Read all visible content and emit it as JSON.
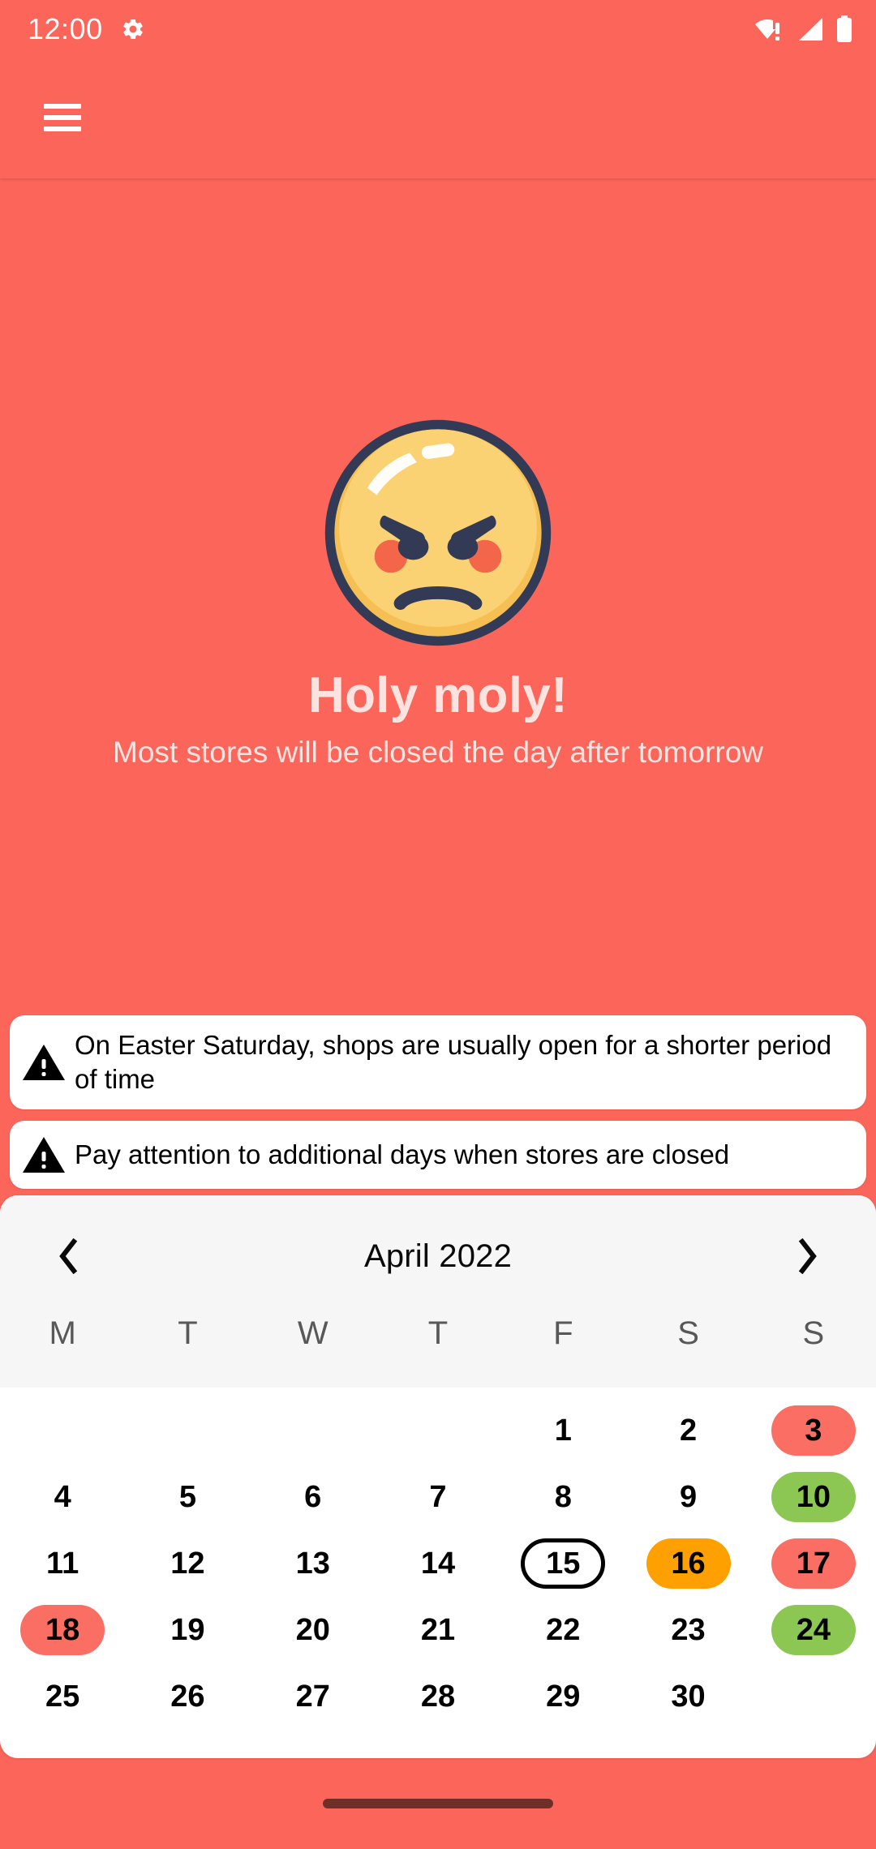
{
  "status_bar": {
    "time": "12:00",
    "icons": [
      "gear-icon",
      "wifi-warning-icon",
      "cell-signal-icon",
      "battery-icon"
    ]
  },
  "app_bar": {
    "menu_icon": "hamburger-menu-icon"
  },
  "hero": {
    "illustration": "angry-face-emoji",
    "title": "Holy moly!",
    "subtitle": "Most stores will be closed the day after tomorrow"
  },
  "warnings": [
    {
      "icon": "warning-triangle-icon",
      "text": "On Easter Saturday, shops are usually open for a shorter period of time"
    },
    {
      "icon": "warning-triangle-icon",
      "text": "Pay attention to additional days when stores are closed"
    }
  ],
  "calendar": {
    "prev_label": "‹",
    "next_label": "›",
    "month": "April 2022",
    "weekdays": [
      "M",
      "T",
      "W",
      "T",
      "F",
      "S",
      "S"
    ],
    "cells": [
      {
        "label": "",
        "state": "empty"
      },
      {
        "label": "",
        "state": "empty"
      },
      {
        "label": "",
        "state": "empty"
      },
      {
        "label": "",
        "state": "empty"
      },
      {
        "label": "1",
        "state": "normal"
      },
      {
        "label": "2",
        "state": "normal"
      },
      {
        "label": "3",
        "state": "red"
      },
      {
        "label": "4",
        "state": "normal"
      },
      {
        "label": "5",
        "state": "normal"
      },
      {
        "label": "6",
        "state": "normal"
      },
      {
        "label": "7",
        "state": "normal"
      },
      {
        "label": "8",
        "state": "normal"
      },
      {
        "label": "9",
        "state": "normal"
      },
      {
        "label": "10",
        "state": "green"
      },
      {
        "label": "11",
        "state": "normal"
      },
      {
        "label": "12",
        "state": "normal"
      },
      {
        "label": "13",
        "state": "normal"
      },
      {
        "label": "14",
        "state": "normal"
      },
      {
        "label": "15",
        "state": "today"
      },
      {
        "label": "16",
        "state": "orange"
      },
      {
        "label": "17",
        "state": "red"
      },
      {
        "label": "18",
        "state": "red"
      },
      {
        "label": "19",
        "state": "normal"
      },
      {
        "label": "20",
        "state": "normal"
      },
      {
        "label": "21",
        "state": "normal"
      },
      {
        "label": "22",
        "state": "normal"
      },
      {
        "label": "23",
        "state": "normal"
      },
      {
        "label": "24",
        "state": "green"
      },
      {
        "label": "25",
        "state": "normal"
      },
      {
        "label": "26",
        "state": "normal"
      },
      {
        "label": "27",
        "state": "normal"
      },
      {
        "label": "28",
        "state": "normal"
      },
      {
        "label": "29",
        "state": "normal"
      },
      {
        "label": "30",
        "state": "normal"
      },
      {
        "label": "",
        "state": "empty"
      }
    ]
  },
  "colors": {
    "background": "#fb655a",
    "card": "#ffffff",
    "calendar_header": "#f6f6f6",
    "day_red": "#fb6e63",
    "day_green": "#8cc653",
    "day_orange": "#fda000",
    "hero_text": "#fde3df",
    "emoji_face": "#fbd06a",
    "emoji_outline": "#323a56",
    "emoji_blush": "#f4664a"
  },
  "gesture_bar": {
    "indicator": "home-gesture-pill"
  }
}
